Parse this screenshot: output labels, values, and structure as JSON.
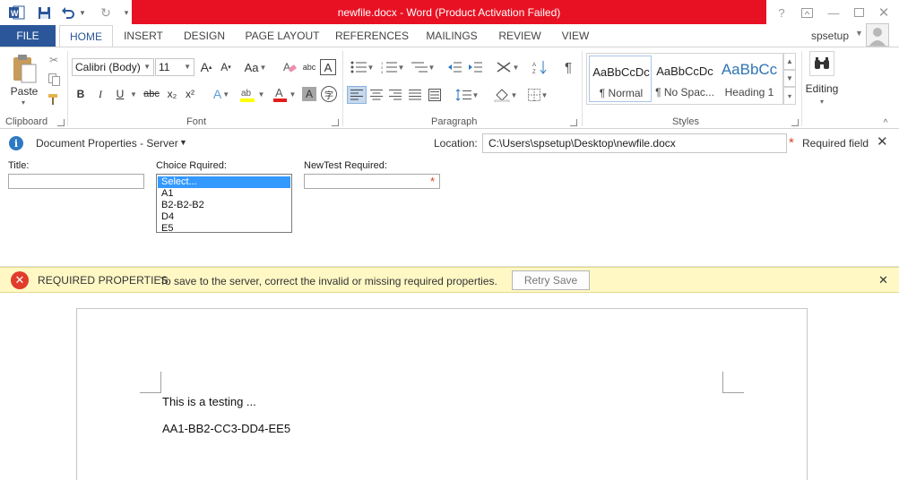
{
  "titlebar": {
    "title": "newfile.docx - Word (Product Activation Failed)",
    "help_label": "?",
    "accent_color": "#e81123"
  },
  "tabs": {
    "file": "FILE",
    "items": [
      "HOME",
      "INSERT",
      "DESIGN",
      "PAGE LAYOUT",
      "REFERENCES",
      "MAILINGS",
      "REVIEW",
      "VIEW"
    ],
    "active": "HOME",
    "user": "spsetup"
  },
  "ribbon": {
    "clipboard": {
      "paste_label": "Paste",
      "group_label": "Clipboard"
    },
    "font": {
      "font_name": "Calibri (Body)",
      "font_size": "11",
      "group_label": "Font",
      "bold": "B",
      "italic": "I",
      "underline": "U",
      "strike": "abc",
      "subscript": "x₂",
      "superscript": "x²",
      "grow": "A",
      "shrink": "A",
      "case": "Aa"
    },
    "paragraph": {
      "group_label": "Paragraph"
    },
    "styles": {
      "group_label": "Styles",
      "items": [
        {
          "sample": "AaBbCcDc",
          "name": "¶ Normal"
        },
        {
          "sample": "AaBbCcDc",
          "name": "¶ No Spac..."
        },
        {
          "sample": "AaBbCc",
          "name": "Heading 1"
        }
      ]
    },
    "editing": {
      "label": "Editing"
    }
  },
  "doc_properties": {
    "title": "Document Properties - Server",
    "location_label": "Location:",
    "location_value": "C:\\Users\\spsetup\\Desktop\\newfile.docx",
    "required_text": "Required field",
    "fields": {
      "title_label": "Title:",
      "choice_label": "Choice Rquired:",
      "choice_options": [
        "Select...",
        "A1",
        "B2-B2-B2",
        "D4",
        "E5"
      ],
      "newtest_label": "NewTest Required:"
    }
  },
  "required_bar": {
    "heading": "REQUIRED PROPERTIES",
    "message": "To save to the server, correct the invalid or missing required properties.",
    "retry_label": "Retry Save"
  },
  "document": {
    "lines": [
      "This is a testing ...",
      "AA1-BB2-CC3-DD4-EE5"
    ]
  }
}
